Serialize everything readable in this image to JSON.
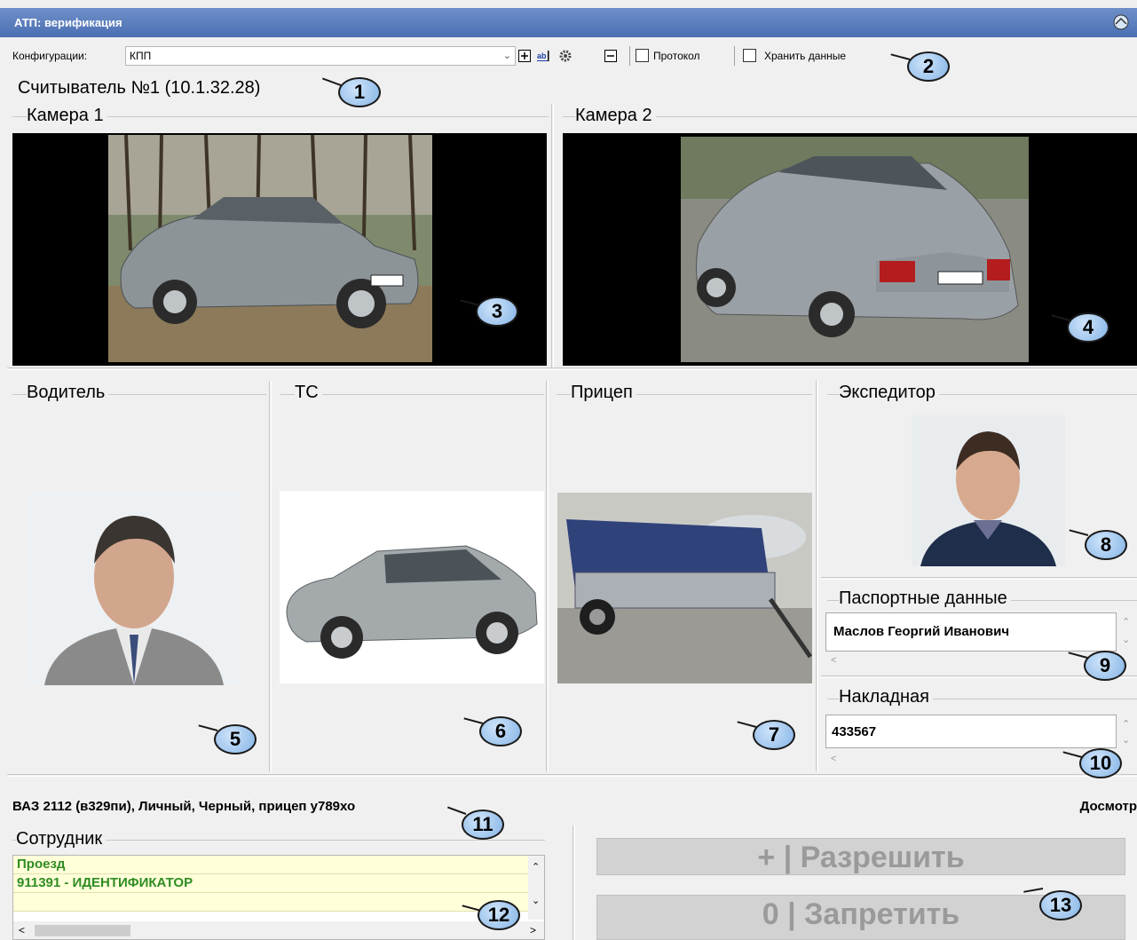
{
  "window": {
    "title": "АТП: верификация"
  },
  "toolbar": {
    "config_label": "Конфигурации:",
    "config_value": "КПП",
    "protocol_label": "Протокол",
    "store_label": "Хранить данные"
  },
  "reader": {
    "label": "Считыватель №1 (10.1.32.28)"
  },
  "cameras": [
    {
      "label": "Камера 1"
    },
    {
      "label": "Камера 2"
    }
  ],
  "panels": {
    "driver": "Водитель",
    "vehicle": "ТС",
    "trailer": "Прицеп",
    "forwarder": "Экспедитор",
    "passport": "Паспортные данные",
    "invoice": "Накладная"
  },
  "fields": {
    "passport_value": "Маслов Георгий Иванович",
    "invoice_value": "433567"
  },
  "status": {
    "vehicle_info": "ВАЗ 2112 (в329пи), Личный, Черный, прицеп у789хо",
    "inspection": "Досмотр"
  },
  "employee": {
    "label": "Сотрудник",
    "rows": [
      "Проезд",
      "911391 - ИДЕНТИФИКАТОР",
      ""
    ]
  },
  "actions": {
    "allow": "+ | Разрешить",
    "deny": "0 | Запретить"
  },
  "callouts": [
    "1",
    "2",
    "3",
    "4",
    "5",
    "6",
    "7",
    "8",
    "9",
    "10",
    "11",
    "12",
    "13"
  ]
}
